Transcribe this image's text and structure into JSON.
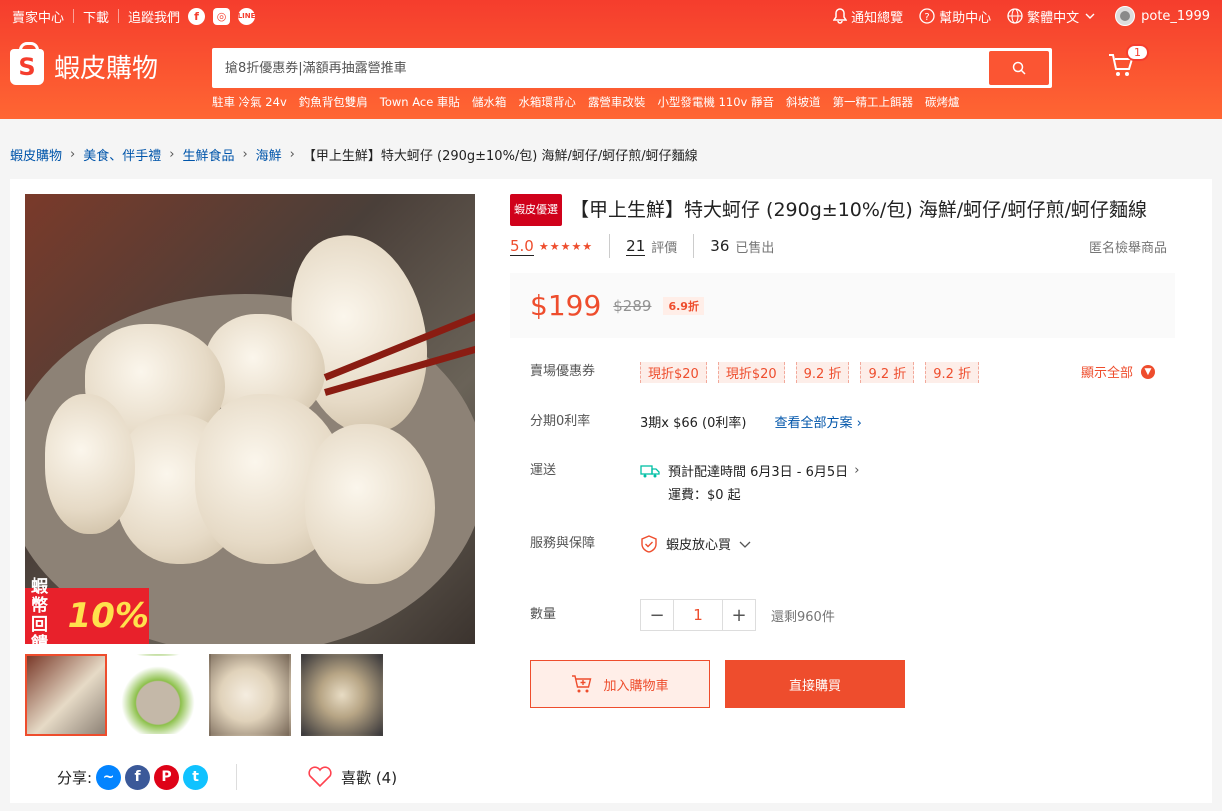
{
  "topbar": {
    "seller_center": "賣家中心",
    "download": "下載",
    "follow_us": "追蹤我們",
    "notifications": "通知總覽",
    "help": "幫助中心",
    "language": "繁體中文",
    "username": "pote_1999"
  },
  "header": {
    "logo_text": "蝦皮購物",
    "search_placeholder": "搶8折優惠券|滿額再抽露營推車",
    "hot_keywords": [
      "駐車 冷氣 24v",
      "釣魚背包雙肩",
      "Town Ace 車貼",
      "儲水箱",
      "水箱環背心",
      "露營車改裝",
      "小型發電機 110v 靜音",
      "斜坡道",
      "第一精工上餌器",
      "碳烤爐"
    ],
    "cart_count": "1"
  },
  "breadcrumb": [
    "蝦皮購物",
    "美食、伴手禮",
    "生鮮食品",
    "海鮮",
    "【甲上生鮮】特大蚵仔 (290g±10%/包) 海鮮/蚵仔/蚵仔煎/蚵仔麵線"
  ],
  "gallery": {
    "badge_line1": "蝦幣",
    "badge_line2": "回饋",
    "badge_pct": "10%",
    "share_label": "分享:",
    "like_label": "喜歡 (4)"
  },
  "product": {
    "tag": "蝦皮優選",
    "title": "【甲上生鮮】特大蚵仔 (290g±10%/包) 海鮮/蚵仔/蚵仔煎/蚵仔麵線",
    "rating": "5.0",
    "reviews": "21",
    "reviews_label": "評價",
    "sold": "36",
    "sold_label": "已售出",
    "report": "匿名檢舉商品",
    "price": "$199",
    "original_price": "$289",
    "discount": "6.9折"
  },
  "details": {
    "voucher_label": "賣場優惠券",
    "vouchers": [
      "現折$20",
      "現折$20",
      "9.2 折",
      "9.2 折",
      "9.2 折"
    ],
    "show_all": "顯示全部",
    "installment_label": "分期0利率",
    "installment_value": "3期x $66 (0利率)",
    "installment_link": "查看全部方案",
    "shipping_label": "運送",
    "shipping_eta": "預計配達時間 6月3日 - 6月5日",
    "shipping_fee": "運費：$0 起",
    "service_label": "服務與保障",
    "service_value": "蝦皮放心買",
    "qty_label": "數量",
    "qty_value": "1",
    "stock": "還剩960件",
    "add_to_cart": "加入購物車",
    "buy_now": "直接購買"
  },
  "colors": {
    "brand": "#ee4d2d",
    "header_top": "#f53d2d",
    "header_bottom": "#ff6633",
    "link": "#0055aa"
  }
}
